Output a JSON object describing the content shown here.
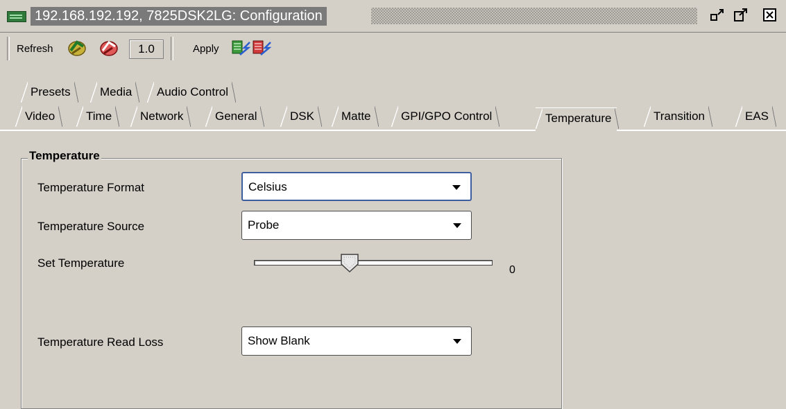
{
  "window": {
    "title": "192.168.192.192, 7825DSK2LG: Configuration"
  },
  "toolbar": {
    "refresh_label": "Refresh",
    "version": "1.0",
    "apply_label": "Apply"
  },
  "tabs_row1": [
    "Presets",
    "Media",
    "Audio Control"
  ],
  "tabs_row2": [
    "Video",
    "Time",
    "Network",
    "General",
    "DSK",
    "Matte",
    "GPI/GPO Control",
    "Temperature",
    "Transition",
    "EAS"
  ],
  "active_tab": "Temperature",
  "group": {
    "title": "Temperature",
    "format_label": "Temperature Format",
    "format_value": "Celsius",
    "source_label": "Temperature Source",
    "source_value": "Probe",
    "set_label": "Set Temperature",
    "set_value": "0",
    "read_loss_label": "Temperature Read Loss",
    "read_loss_value": "Show Blank"
  },
  "colors": {
    "background": "#d4d0c8",
    "focus_border": "#3c5d9e"
  }
}
